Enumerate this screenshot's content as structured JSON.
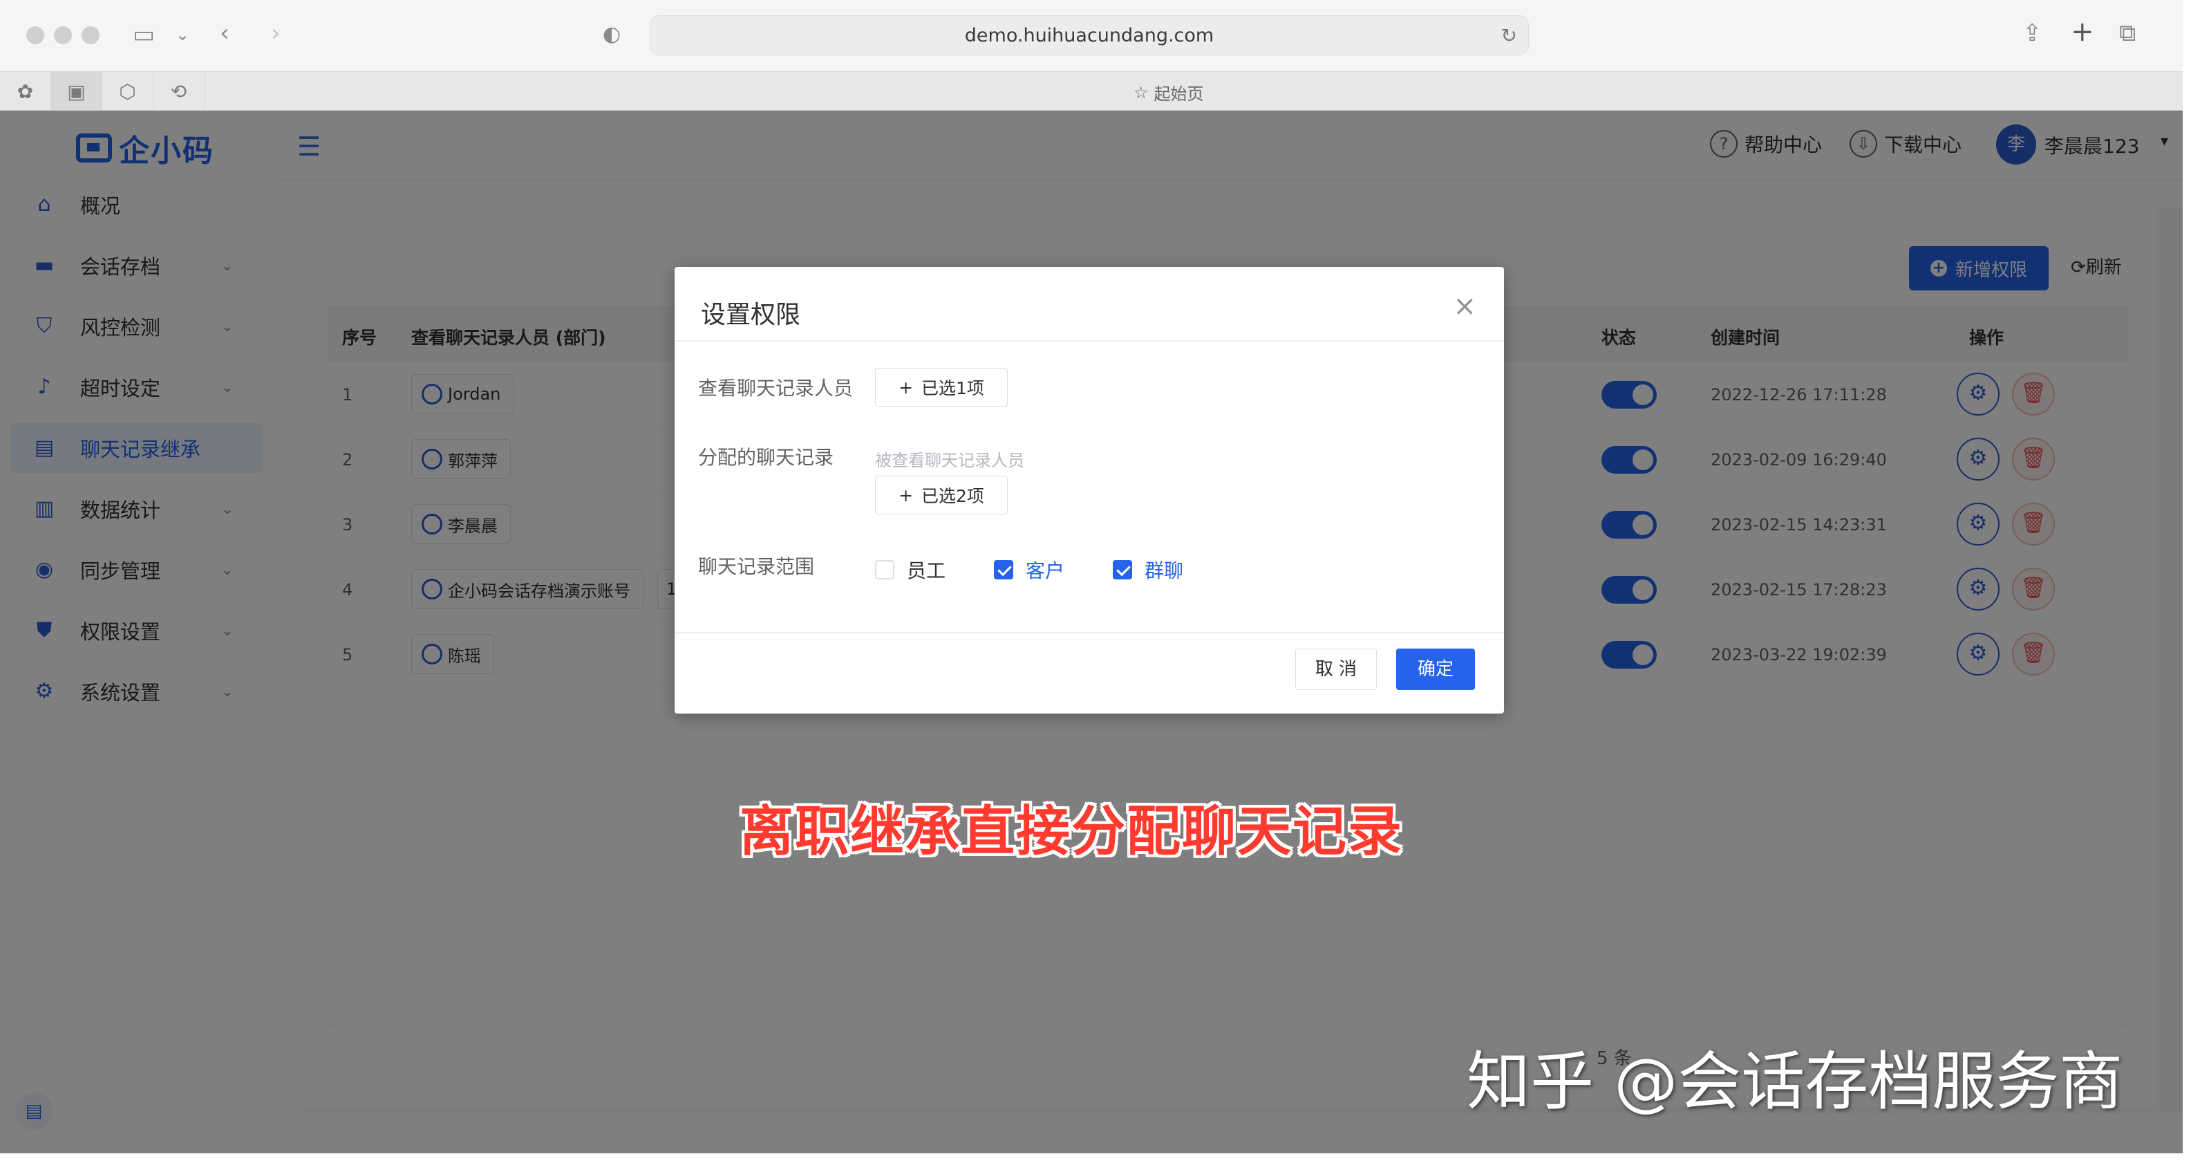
{
  "browser": {
    "url": "demo.huihuacundang.com",
    "start_tab_label": "起始页"
  },
  "app": {
    "logo_text": "企小码",
    "sidebar": {
      "items": [
        {
          "label": "概况",
          "icon": "home-icon",
          "has_submenu": false,
          "active": false
        },
        {
          "label": "会话存档",
          "icon": "folder-icon",
          "has_submenu": true,
          "active": false
        },
        {
          "label": "风控检测",
          "icon": "shield-icon",
          "has_submenu": true,
          "active": false
        },
        {
          "label": "超时设定",
          "icon": "bell-icon",
          "has_submenu": true,
          "active": false
        },
        {
          "label": "聊天记录继承",
          "icon": "chat-transfer-icon",
          "has_submenu": false,
          "active": true
        },
        {
          "label": "数据统计",
          "icon": "bar-chart-icon",
          "has_submenu": true,
          "active": false
        },
        {
          "label": "同步管理",
          "icon": "sync-icon",
          "has_submenu": true,
          "active": false
        },
        {
          "label": "权限设置",
          "icon": "permission-shield-icon",
          "has_submenu": true,
          "active": false
        },
        {
          "label": "系统设置",
          "icon": "gear-icon",
          "has_submenu": true,
          "active": false
        }
      ]
    },
    "header": {
      "help_label": "帮助中心",
      "download_label": "下载中心",
      "avatar_text": "李",
      "username": "李晨晨123"
    },
    "toolbar": {
      "add_label": "新增权限",
      "refresh_label": "刷新"
    },
    "table": {
      "columns": {
        "index": "序号",
        "viewer": "查看聊天记录人员 (部门)",
        "status": "状态",
        "created": "创建时间",
        "actions": "操作"
      },
      "rows": [
        {
          "index": "1",
          "viewer": "Jordan",
          "extra": "",
          "status_on": true,
          "created": "2022-12-26 17:11:28"
        },
        {
          "index": "2",
          "viewer": "郭萍萍",
          "extra": "",
          "status_on": true,
          "created": "2023-02-09 16:29:40"
        },
        {
          "index": "3",
          "viewer": "李晨晨",
          "extra": "",
          "status_on": true,
          "created": "2023-02-15 14:23:31"
        },
        {
          "index": "4",
          "viewer": "企小码会话存档演示账号",
          "extra": "1",
          "status_on": true,
          "created": "2023-02-15 17:28:23"
        },
        {
          "index": "5",
          "viewer": "陈瑶",
          "extra": "",
          "status_on": true,
          "created": "2023-03-22 19:02:39"
        }
      ],
      "pagination_text": "5 条"
    }
  },
  "dialog": {
    "title": "设置权限",
    "viewer_label": "查看聊天记录人员",
    "viewer_button": "已选1项",
    "assigned_label": "分配的聊天记录",
    "assigned_hint": "被查看聊天记录人员",
    "assigned_button": "已选2项",
    "scope_label": "聊天记录范围",
    "scope_options": [
      {
        "label": "员工",
        "checked": false
      },
      {
        "label": "客户",
        "checked": true
      },
      {
        "label": "群聊",
        "checked": true
      }
    ],
    "cancel_label": "取 消",
    "confirm_label": "确定"
  },
  "overlay_caption": "离职继承直接分配聊天记录",
  "watermark": "知乎 @会话存档服务商",
  "colors": {
    "accent": "#2563eb",
    "danger": "#e55353"
  }
}
